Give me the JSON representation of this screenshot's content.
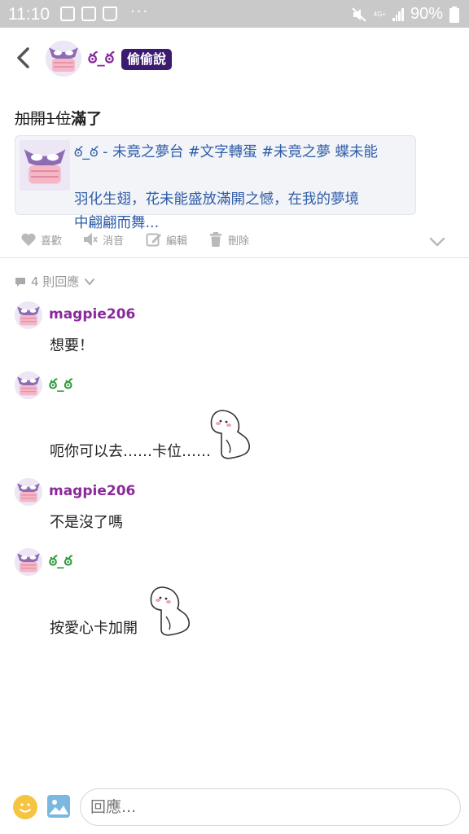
{
  "status_bar": {
    "time": "11:10",
    "dots": "···",
    "network": "4G+",
    "battery": "90%"
  },
  "header": {
    "author_name": "ᴏ̲_ᴏ",
    "author_display": "ఠ_ఠ",
    "badge": "偷偷說"
  },
  "post": {
    "text_strike": "加開1位",
    "text_bold": "滿了",
    "link_card": {
      "line1": "ఠ_ఠ - 未竟之夢台 #文字轉蛋 #未竟之夢 蝶未能",
      "line2": "羽化生翅，花未能盛放滿開之憾，在我的夢境",
      "line3": "中翩翩而舞..."
    }
  },
  "actions": {
    "like": "喜歡",
    "mute": "消音",
    "edit": "編輯",
    "delete": "刪除"
  },
  "reply_count": "4 則回應",
  "comments": [
    {
      "author": "magpie206",
      "text": "想要！"
    },
    {
      "author": "ఠ_ఠ",
      "text": "呃你可以去……卡位……"
    },
    {
      "author": "magpie206",
      "text": "不是沒了嗎"
    },
    {
      "author": "ఠ_ఠ",
      "text": "按愛心卡加開"
    }
  ],
  "reply_box": {
    "placeholder": "回應..."
  },
  "colors": {
    "badge_bg": "#3c1a6f",
    "author_purple": "#8a2a9a",
    "author_green": "#2e9b3a",
    "link_blue": "#2f5da8"
  }
}
